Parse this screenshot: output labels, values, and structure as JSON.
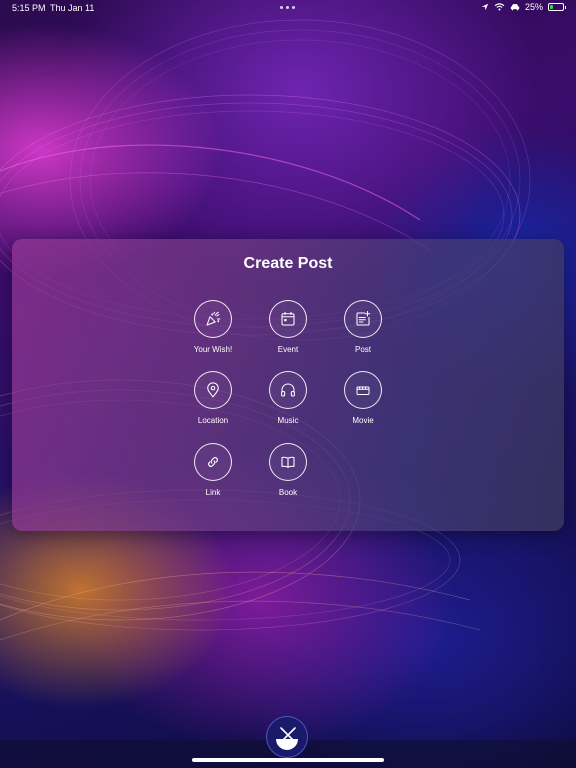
{
  "status_bar": {
    "time": "5:15 PM",
    "date": "Thu Jan 11",
    "battery": "25%",
    "battery_level": 0.25,
    "icons": [
      "location-arrow-icon",
      "wifi-icon",
      "car-icon",
      "battery-charging-icon"
    ]
  },
  "modal": {
    "title": "Create Post",
    "options": [
      {
        "label": "Your Wish!",
        "icon": "party-popper-icon"
      },
      {
        "label": "Event",
        "icon": "calendar-icon"
      },
      {
        "label": "Post",
        "icon": "post-add-icon"
      },
      {
        "label": "Location",
        "icon": "map-pin-icon"
      },
      {
        "label": "Music",
        "icon": "headphones-icon"
      },
      {
        "label": "Movie",
        "icon": "clapperboard-icon"
      },
      {
        "label": "Link",
        "icon": "link-icon"
      },
      {
        "label": "Book",
        "icon": "open-book-icon"
      }
    ]
  },
  "dock": {
    "close_button": "close-icon"
  },
  "colors": {
    "card_tint": "#7a3c8c",
    "battery_fill": "#3ed45a",
    "fab": "#1a1a6a"
  }
}
